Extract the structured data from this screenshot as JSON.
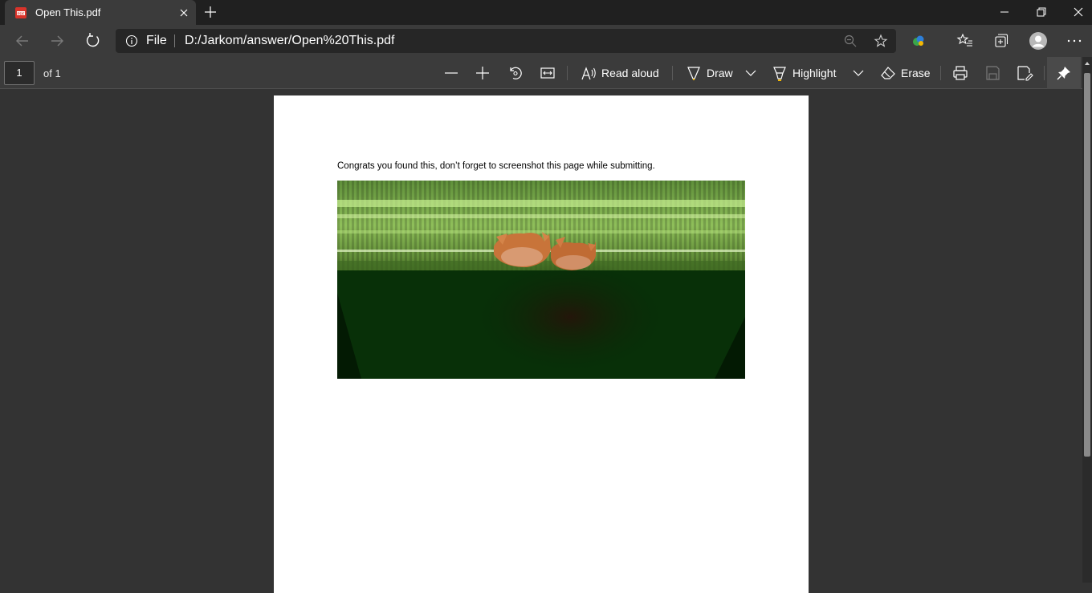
{
  "tab": {
    "title": "Open This.pdf"
  },
  "address": {
    "scheme": "File",
    "url": "D:/Jarkom/answer/Open%20This.pdf"
  },
  "pdf_toolbar": {
    "page_number": "1",
    "page_total": "of 1",
    "read_aloud_label": "Read aloud",
    "draw_label": "Draw",
    "highlight_label": "Highlight",
    "erase_label": "Erase"
  },
  "document": {
    "text": "Congrats you found this, don’t forget to screenshot this page while submitting."
  },
  "colors": {
    "draw_highlight_accent": "#f2b705",
    "pdf_favicon": "#d9342b"
  }
}
